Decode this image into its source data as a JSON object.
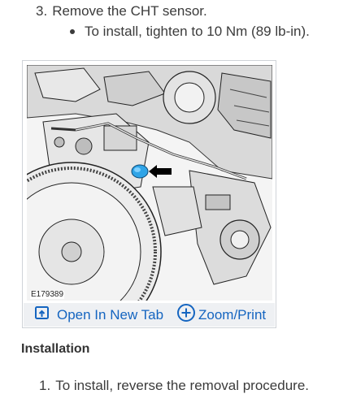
{
  "removal": {
    "step_number": "3.",
    "step_text": "Remove the CHT sensor.",
    "sub_bullet": "To install, tighten to 10 Nm (89 lb-in)."
  },
  "figure": {
    "code": "E179389",
    "image_subject": "engine illustration with arrow pointing to CHT sensor",
    "actions": {
      "open_tab": "Open In New Tab",
      "zoom_print": "Zoom/Print"
    },
    "icons": {
      "open_tab": "open-in-new-tab-icon",
      "zoom_print": "zoom-plus-icon"
    }
  },
  "installation": {
    "title": "Installation",
    "step_number": "1.",
    "step_text": "To install, reverse the removal procedure."
  },
  "colors": {
    "link": "#1565c0",
    "sensor_highlight": "#2fa4e7",
    "bar_background": "#eef0f3"
  }
}
